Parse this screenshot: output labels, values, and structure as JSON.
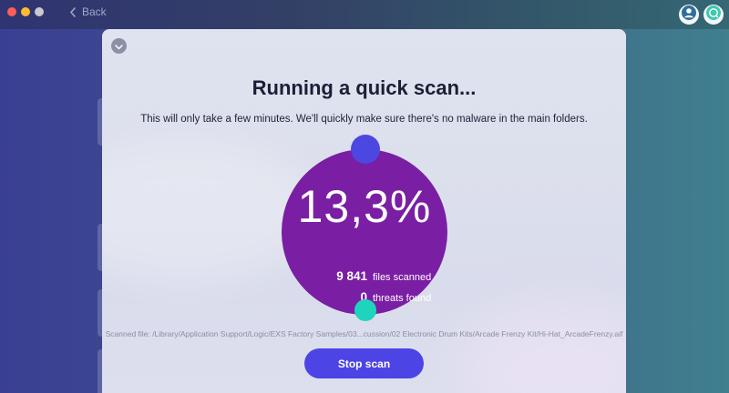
{
  "titlebar": {
    "back_label": "Back",
    "icons": [
      "chevron-left-icon",
      "user-icon",
      "chat-icon"
    ]
  },
  "scan": {
    "title": "Running a quick scan...",
    "subtitle": "This will only take a few minutes. We'll quickly make sure there's no malware in the main folders.",
    "progress_label": "13,3%",
    "progress": 0.133,
    "files_count": "9 841",
    "files_label": "files scanned",
    "threats_count": "0",
    "threats_label": "threats found",
    "scanned_file": "Scanned file: /Library/Application Support/Logic/EXS Factory Samples/03...cussion/02 Electronic Drum Kits/Arcade Frenzy Kit/Hi-Hat_ArcadeFrenzy.aif",
    "stop_label": "Stop scan"
  },
  "colors": {
    "accent": "#4d44e6",
    "circle": "#7a1ea3",
    "teal": "#1fd4bd"
  }
}
